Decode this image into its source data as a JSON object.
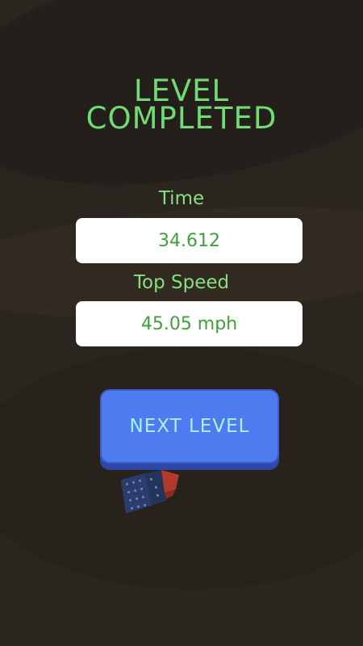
{
  "title": {
    "line1": "LEVEL",
    "line2": "COMPLETED"
  },
  "stats": {
    "time_label": "Time",
    "time_value": "34.612",
    "speed_label": "Top Speed",
    "speed_value": "45.05 mph"
  },
  "next_button": {
    "label": "NEXT LEVEL"
  },
  "colors": {
    "background": "#2a251e",
    "title_text": "#6fdc74",
    "stat_value_text": "#3f9f3a",
    "button_fill": "#4f7bf0",
    "button_text": "#a6f4ff"
  },
  "icons": {
    "car": "car-icon"
  }
}
